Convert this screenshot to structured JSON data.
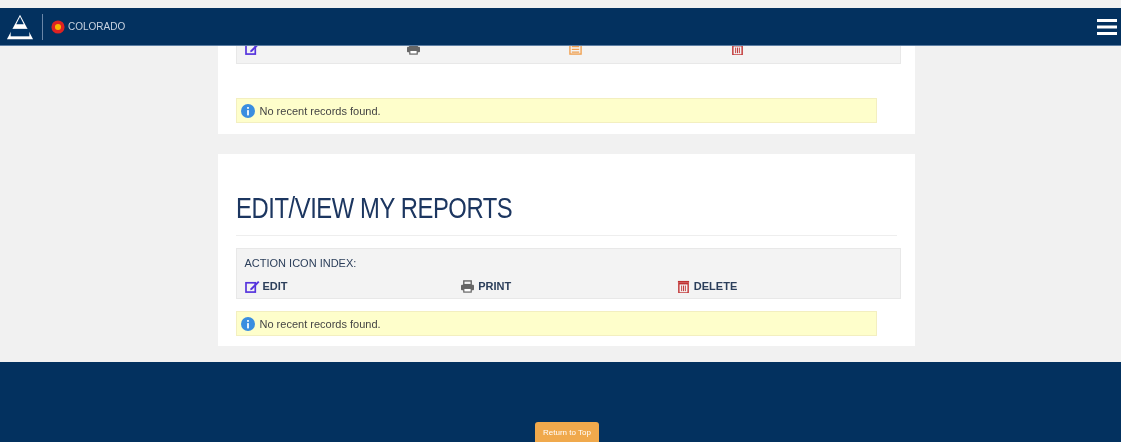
{
  "header": {
    "brand": "COLORADO"
  },
  "sections": [
    {
      "actions": [
        {
          "kind": "edit"
        },
        {
          "kind": "print"
        },
        {
          "kind": "report"
        },
        {
          "kind": "delete"
        }
      ],
      "message": "No recent records found."
    },
    {
      "title": "EDIT/VIEW MY REPORTS",
      "legend": "ACTION ICON INDEX:",
      "actions": [
        {
          "kind": "edit",
          "label": "EDIT"
        },
        {
          "kind": "print",
          "label": "PRINT"
        },
        {
          "kind": "delete",
          "label": "DELETE"
        }
      ],
      "message": "No recent records found."
    }
  ],
  "footer": {
    "button": "Return to Top"
  }
}
